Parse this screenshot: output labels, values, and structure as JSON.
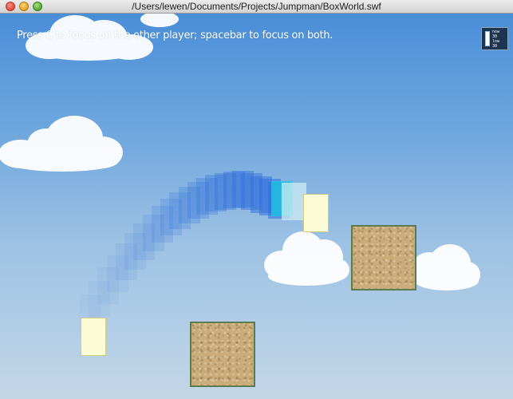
{
  "window": {
    "title": "/Users/lewen/Documents/Projects/Jumpman/BoxWorld.swf"
  },
  "hud": {
    "hint": "Press C to focus on the other player; spacebar to focus on both.",
    "fps_meter": {
      "lines": [
        "now",
        "30",
        "low",
        "30"
      ]
    }
  },
  "scene": {
    "players": [
      "player-1",
      "player-2"
    ],
    "crates": [
      "crate-1",
      "crate-2"
    ]
  },
  "colors": {
    "sky_top": "#4a8ed8",
    "sky_bottom": "#c3d7e7",
    "player_fill": "#fbfbd6",
    "crate_border": "#5b7a4f",
    "trail": "#2f6ddb"
  }
}
